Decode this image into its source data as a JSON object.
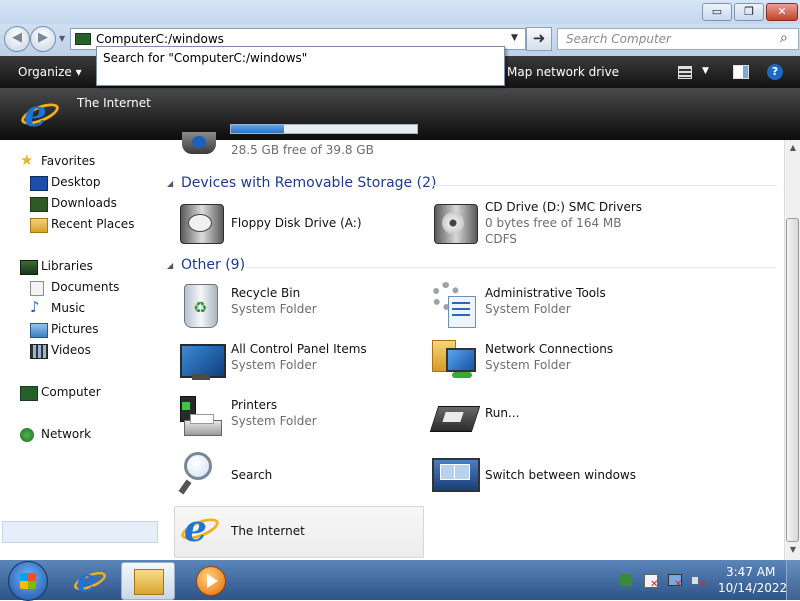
{
  "window": {
    "minimize_label": "▭",
    "maximize_label": "❐",
    "close_label": "✕"
  },
  "nav": {
    "address_text": "ComputerC:/windows",
    "address_suggestion": "Search for \"ComputerC:/windows\"",
    "search_placeholder": "Search Computer"
  },
  "toolbar": {
    "organize_label": "Organize ▾",
    "map_drive_label": "Map network drive",
    "help_label": "?"
  },
  "banner": {
    "title": "The Internet"
  },
  "sidebar": {
    "favorites": "Favorites",
    "desktop": "Desktop",
    "downloads": "Downloads",
    "recent_places": "Recent Places",
    "libraries": "Libraries",
    "documents": "Documents",
    "music": "Music",
    "pictures": "Pictures",
    "videos": "Videos",
    "computer": "Computer",
    "network": "Network"
  },
  "content": {
    "hard_disk": {
      "free_text": "28.5 GB free of 39.8 GB",
      "used_fraction": 0.284
    },
    "removable_heading": "Devices with Removable Storage (2)",
    "floppy": {
      "name": "Floppy Disk Drive (A:)"
    },
    "cd": {
      "name": "CD Drive (D:) SMC Drivers",
      "free": "0 bytes free of 164 MB",
      "fs": "CDFS"
    },
    "other_heading": "Other (9)",
    "recycle": {
      "name": "Recycle Bin",
      "type": "System Folder"
    },
    "admin": {
      "name": "Administrative Tools",
      "type": "System Folder"
    },
    "control_panel": {
      "name": "All Control Panel Items",
      "type": "System Folder"
    },
    "network_conn": {
      "name": "Network Connections",
      "type": "System Folder"
    },
    "printers": {
      "name": "Printers",
      "type": "System Folder"
    },
    "run": {
      "name": "Run..."
    },
    "search": {
      "name": "Search"
    },
    "switch_windows": {
      "name": "Switch between windows"
    },
    "internet": {
      "name": "The Internet"
    }
  },
  "taskbar": {
    "time": "3:47 AM",
    "date": "10/14/2022"
  }
}
